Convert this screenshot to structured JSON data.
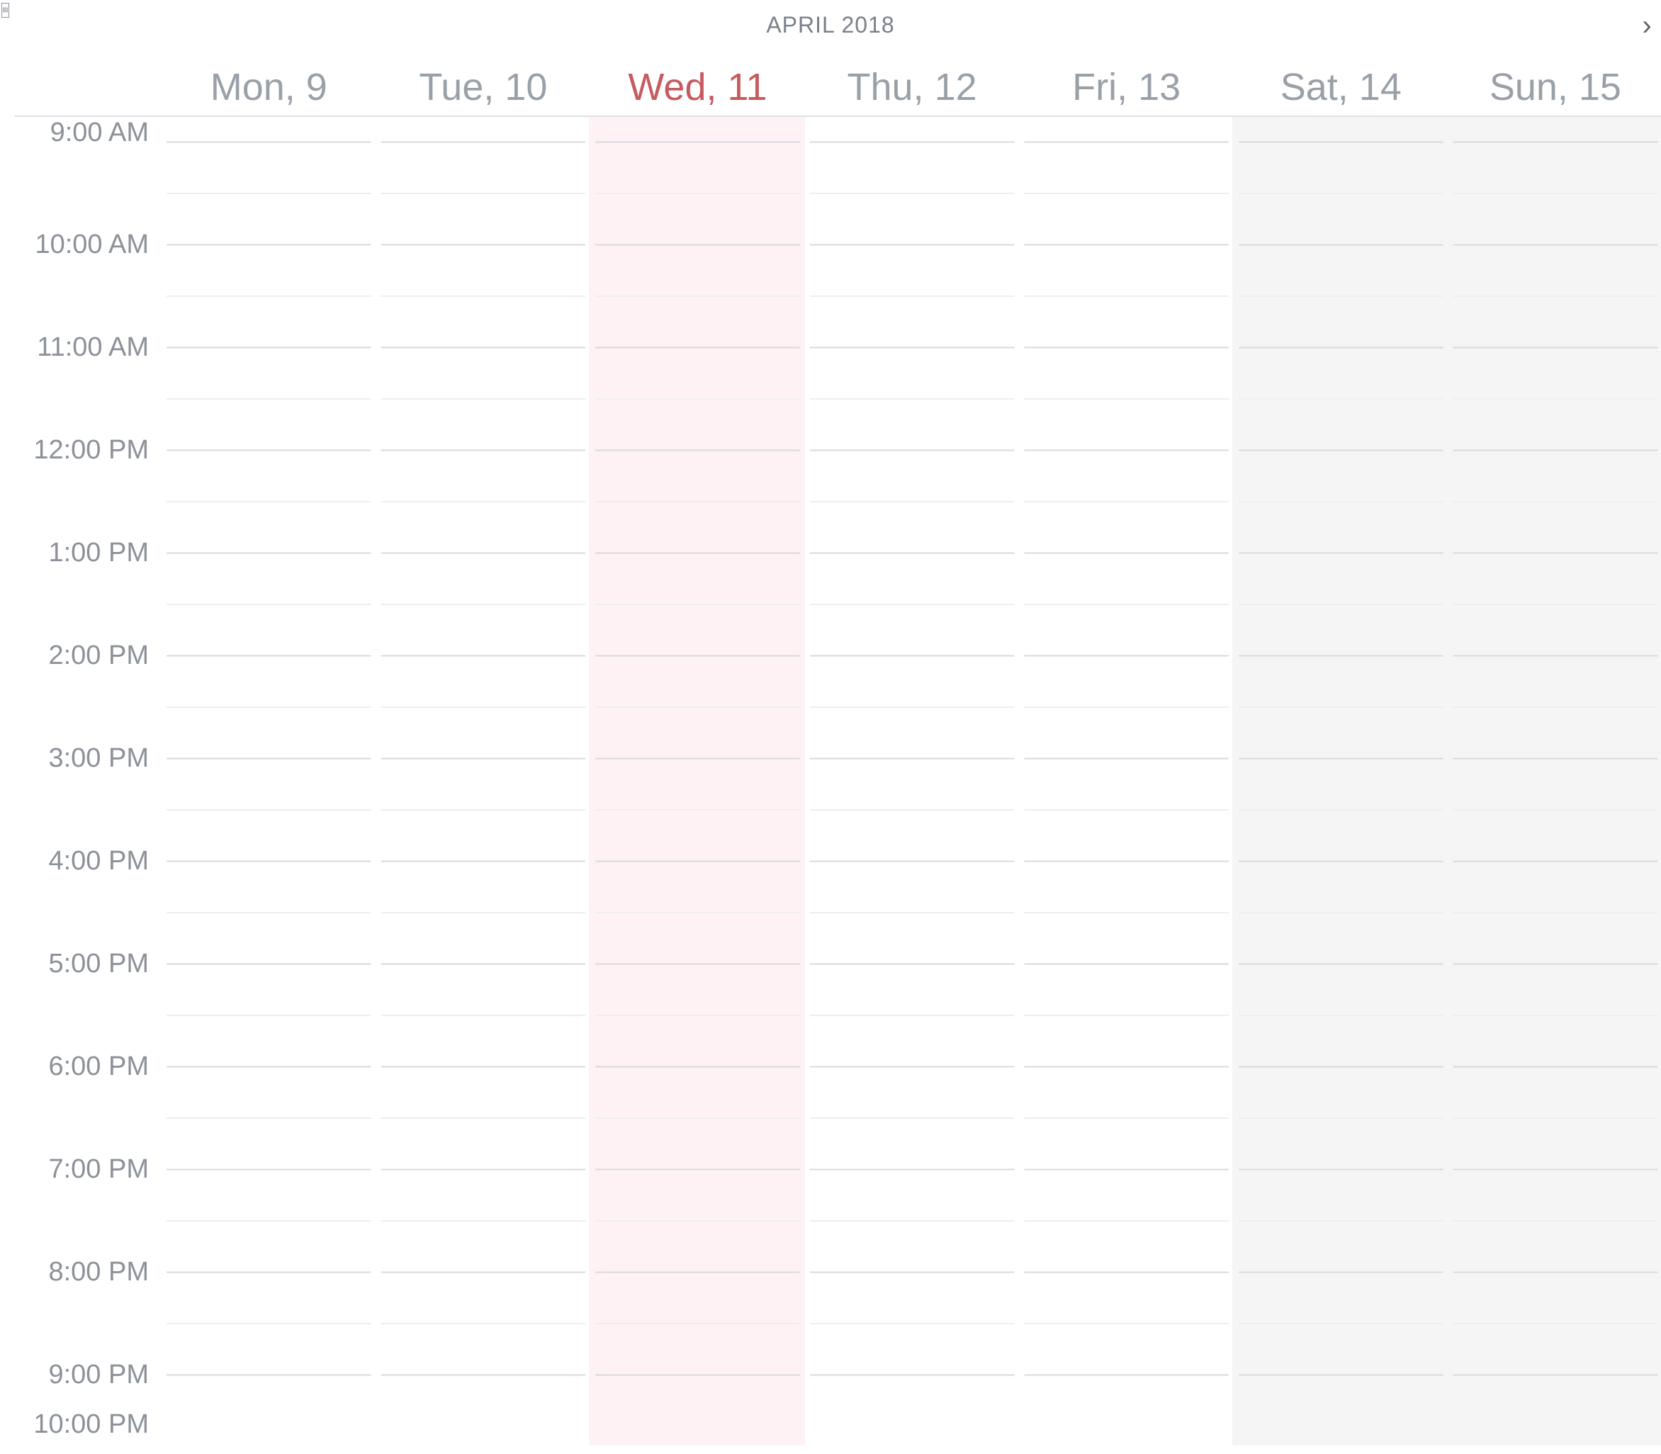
{
  "header": {
    "broken_image_glyph": "⊠",
    "month_title": "APRIL 2018",
    "next_glyph": "›"
  },
  "days": [
    {
      "label": "Mon, 9",
      "today": false,
      "weekend": false
    },
    {
      "label": "Tue, 10",
      "today": false,
      "weekend": false
    },
    {
      "label": "Wed, 11",
      "today": true,
      "weekend": false
    },
    {
      "label": "Thu, 12",
      "today": false,
      "weekend": false
    },
    {
      "label": "Fri, 13",
      "today": false,
      "weekend": false
    },
    {
      "label": "Sat, 14",
      "today": false,
      "weekend": true
    },
    {
      "label": "Sun, 15",
      "today": false,
      "weekend": true
    }
  ],
  "times": [
    "9:00 AM",
    "10:00 AM",
    "11:00 AM",
    "12:00 PM",
    "1:00 PM",
    "2:00 PM",
    "3:00 PM",
    "4:00 PM",
    "5:00 PM",
    "6:00 PM",
    "7:00 PM",
    "8:00 PM",
    "9:00 PM",
    "10:00 PM"
  ],
  "colors": {
    "today_text": "#c75a5f",
    "today_column": "#fef2f5",
    "weekend_column": "#f5f5f5",
    "muted_text": "#9aa0a8",
    "hour_line": "#d8dadf",
    "half_hour_line": "#eceef1"
  }
}
